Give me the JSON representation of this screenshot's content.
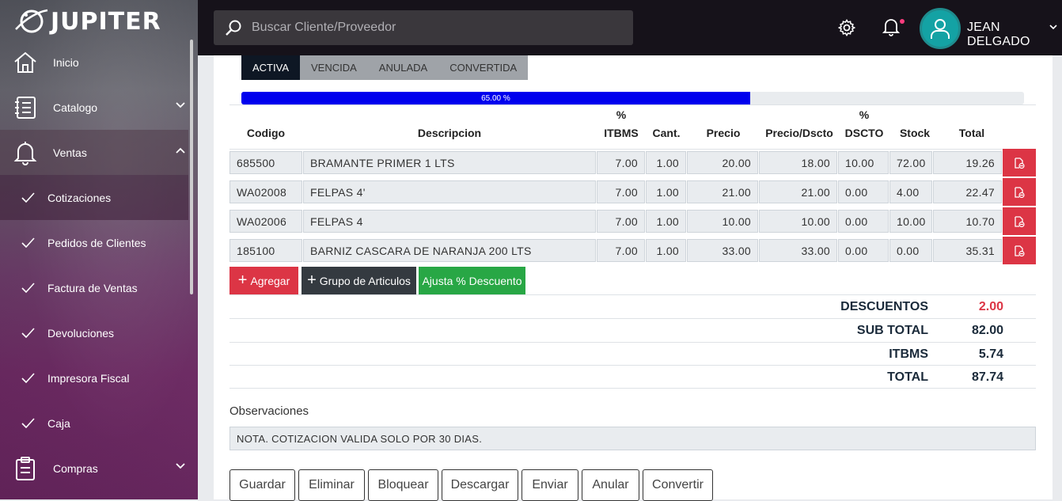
{
  "app": {
    "name": "JUPITER"
  },
  "sidebar": {
    "items": [
      {
        "label": "Inicio",
        "icon": "home-icon"
      },
      {
        "label": "Catalogo",
        "icon": "catalog-icon"
      },
      {
        "label": "Ventas",
        "icon": "bell-icon"
      },
      {
        "label": "Compras",
        "icon": "clipboard-icon"
      }
    ],
    "ventas_sub": [
      {
        "label": "Cotizaciones"
      },
      {
        "label": "Pedidos de Clientes"
      },
      {
        "label": "Factura de Ventas"
      },
      {
        "label": "Devoluciones"
      },
      {
        "label": "Impresora Fiscal"
      },
      {
        "label": "Caja"
      }
    ]
  },
  "header": {
    "search_placeholder": "Buscar Cliente/Proveedor",
    "username": "JEAN DELGADO"
  },
  "tabs": [
    "ACTIVA",
    "VENCIDA",
    "ANULADA",
    "CONVERTIDA"
  ],
  "progress": {
    "value": 0.65,
    "label": "65.00 %",
    "color": "#0000ee"
  },
  "table": {
    "columns": {
      "codigo": "Codigo",
      "descripcion": "Descripcion",
      "itbms_pct": "%",
      "itbms": "ITBMS",
      "cant": "Cant.",
      "precio": "Precio",
      "precio_dscto": "Precio/Dscto",
      "dscto_pct": "%",
      "dscto": "DSCTO",
      "stock": "Stock",
      "total": "Total"
    },
    "rows": [
      {
        "codigo": "685500",
        "descripcion": "BRAMANTE PRIMER 1 LTS",
        "itbms": "7.00",
        "cant": "1.00",
        "precio": "20.00",
        "precio_dscto": "18.00",
        "dscto": "10.00",
        "stock": "72.00",
        "total": "19.26"
      },
      {
        "codigo": "WA02008",
        "descripcion": "FELPAS 4'",
        "itbms": "7.00",
        "cant": "1.00",
        "precio": "21.00",
        "precio_dscto": "21.00",
        "dscto": "0.00",
        "stock": "4.00",
        "total": "22.47"
      },
      {
        "codigo": "WA02006",
        "descripcion": "FELPAS 4",
        "itbms": "7.00",
        "cant": "1.00",
        "precio": "10.00",
        "precio_dscto": "10.00",
        "dscto": "0.00",
        "stock": "10.00",
        "total": "10.70"
      },
      {
        "codigo": "185100",
        "descripcion": "BARNIZ CASCARA DE NARANJA 200 LTS",
        "itbms": "7.00",
        "cant": "1.00",
        "precio": "33.00",
        "precio_dscto": "33.00",
        "dscto": "0.00",
        "stock": "0.00",
        "total": "35.31"
      }
    ]
  },
  "buttons": {
    "agregar": "Agregar",
    "grupo": "Grupo de Articulos",
    "ajusta": "Ajusta % Descuento"
  },
  "totals": {
    "descuentos_label": "DESCUENTOS",
    "descuentos": "2.00",
    "subtotal_label": "SUB TOTAL",
    "subtotal": "82.00",
    "itbms_label": "ITBMS",
    "itbms": "5.74",
    "total_label": "TOTAL",
    "total": "87.74"
  },
  "observaciones": {
    "label": "Observaciones",
    "value": "NOTA.  COTIZACION VALIDA SOLO POR 30 DIAS."
  },
  "actions": [
    "Guardar",
    "Eliminar",
    "Bloquear",
    "Descargar",
    "Enviar",
    "Anular",
    "Convertir"
  ],
  "colors": {
    "accent_red": "#dc3545",
    "accent_green": "#28a745",
    "dark": "#343a40",
    "tab_active": "#0e1724",
    "discount_red": "#dc3545"
  }
}
